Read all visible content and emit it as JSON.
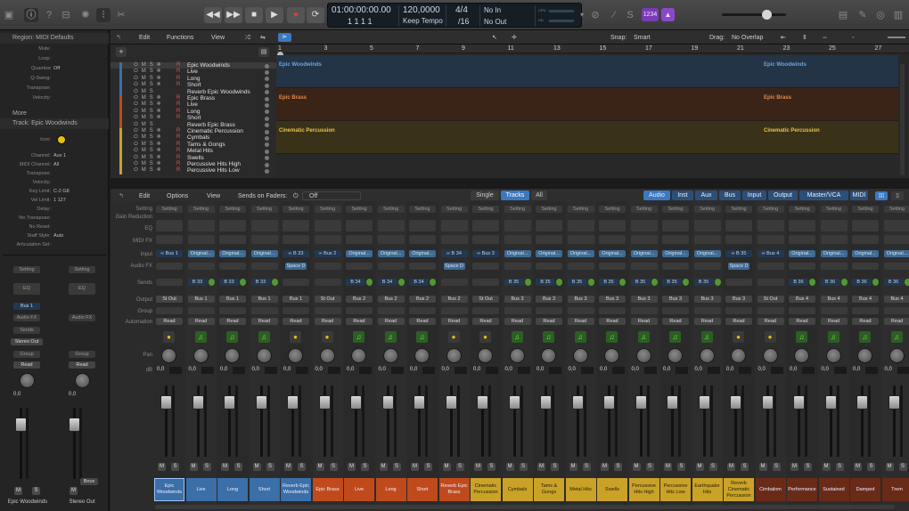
{
  "control_bar": {
    "lcd": {
      "timecode": "01:00:00:00.00",
      "bars": "1  1  1  1",
      "tempo": "120,0000",
      "tempo_mode": "Keep Tempo",
      "signature": "4/4",
      "division": "/16",
      "in": "No In",
      "out": "No Out",
      "cpu_label": "CPU",
      "hd_label": "HD"
    },
    "badge": "1234"
  },
  "inspector": {
    "region_header": "Region: MIDI Defaults",
    "region_rows": [
      {
        "k": "Mute:",
        "v": ""
      },
      {
        "k": "Loop:",
        "v": ""
      },
      {
        "k": "Quantize",
        "v": "Off"
      },
      {
        "k": "Q-Swing:",
        "v": ""
      },
      {
        "k": "Transpose:",
        "v": ""
      },
      {
        "k": "Velocity:",
        "v": ""
      }
    ],
    "more": "More",
    "track_header": "Track: Epic Woodwinds",
    "track_rows": [
      {
        "k": "Icon:",
        "v": ""
      },
      {
        "k": "Channel:",
        "v": "Aux 1"
      },
      {
        "k": "MIDI Channel:",
        "v": "All"
      },
      {
        "k": "Transpose:",
        "v": ""
      },
      {
        "k": "Velocity:",
        "v": ""
      },
      {
        "k": "Key Limit:",
        "v": "C-2  G8"
      },
      {
        "k": "Vel Limit:",
        "v": "1  127"
      },
      {
        "k": "Delay:",
        "v": ""
      },
      {
        "k": "No Transpose:",
        "v": ""
      },
      {
        "k": "No Reset:",
        "v": ""
      },
      {
        "k": "Staff Style:",
        "v": "Auto"
      },
      {
        "k": "Articulation Set:",
        "v": ""
      }
    ],
    "strip_left": {
      "setting": "Setting",
      "eq": "EQ",
      "input": "Bus 1",
      "audio_fx": "Audio FX",
      "sends": "Sends",
      "output": "Stereo Out",
      "group": "Group",
      "automation": "Read",
      "value": "0,0",
      "name": "Epic Woodwinds"
    },
    "strip_right": {
      "setting": "Setting",
      "eq": "EQ",
      "audio_fx": "Audio FX",
      "group": "Group",
      "automation": "Read",
      "value": "0,0",
      "name": "Stereo Out",
      "bounce": "Bnce"
    }
  },
  "tracks_menu": {
    "edit": "Edit",
    "functions": "Functions",
    "view": "View",
    "snap_label": "Snap:",
    "snap_value": "Smart",
    "drag_label": "Drag:",
    "drag_value": "No Overlap"
  },
  "ruler": [
    "1",
    "3",
    "5",
    "7",
    "9",
    "11",
    "13",
    "15",
    "17",
    "19",
    "21",
    "23",
    "25",
    "27"
  ],
  "tracks": [
    {
      "name": "Epic Woodwinds",
      "color": "#3a6fa8",
      "rec": true
    },
    {
      "name": "Live",
      "color": "#3a6fa8",
      "rec": true
    },
    {
      "name": "Long",
      "color": "#3a6fa8",
      "rec": true
    },
    {
      "name": "Short",
      "color": "#3a6fa8",
      "rec": true
    },
    {
      "name": "Reverb Epic Woodwinds",
      "color": "#3a6fa8",
      "rec": false
    },
    {
      "name": "Epic Brass",
      "color": "#c04a1c",
      "rec": true
    },
    {
      "name": "Live",
      "color": "#c04a1c",
      "rec": true
    },
    {
      "name": "Long",
      "color": "#c04a1c",
      "rec": true
    },
    {
      "name": "Short",
      "color": "#c04a1c",
      "rec": true
    },
    {
      "name": "Reverb Epic Brass",
      "color": "#c04a1c",
      "rec": false
    },
    {
      "name": "Cinematic Percussion",
      "color": "#c9a227",
      "rec": true
    },
    {
      "name": "Cymbals",
      "color": "#c9a227",
      "rec": true
    },
    {
      "name": "Tams & Gongs",
      "color": "#c9a227",
      "rec": true
    },
    {
      "name": "Metal Hits",
      "color": "#c9a227",
      "rec": true
    },
    {
      "name": "Swells",
      "color": "#c9a227",
      "rec": true
    },
    {
      "name": "Percussive Hits High",
      "color": "#c9a227",
      "rec": true
    },
    {
      "name": "Percussive Hits Low",
      "color": "#c9a227",
      "rec": true
    }
  ],
  "regions": [
    {
      "label": "Epic Woodwinds",
      "label2": "Epic Woodwinds",
      "color": "#6fa2d8"
    },
    {
      "label": "Epic Brass",
      "label2": "Epic Brass",
      "color": "#e0884f"
    },
    {
      "label": "Cinematic Percussion",
      "label2": "Cinematic Percussion",
      "color": "#e8c24a"
    }
  ],
  "mixer_menu": {
    "edit": "Edit",
    "options": "Options",
    "view": "View",
    "sends_on_faders": "Sends on Faders:",
    "sends_value": "Off",
    "modes": [
      "Single",
      "Tracks",
      "All"
    ],
    "filters": [
      "Audio",
      "Inst",
      "Aux",
      "Bus",
      "Input",
      "Output",
      "Master/VCA",
      "MIDI"
    ]
  },
  "row_labels": {
    "setting": "Setting",
    "gain": "Gain Reduction",
    "eq": "EQ",
    "midi_fx": "MIDI FX",
    "input": "Input",
    "audio_fx": "Audio FX",
    "sends": "Sends",
    "output": "Output",
    "group": "Group",
    "automation": "Automation",
    "pan": "Pan",
    "db": "dB"
  },
  "channels": [
    {
      "name": "Epic Woodwinds",
      "color": "#3a6fa8",
      "type": "aux",
      "input": "Bus 1",
      "insert": "",
      "send": "",
      "output": "St Out",
      "value": "0,0"
    },
    {
      "name": "Live",
      "color": "#3a6fa8",
      "type": "inst",
      "input": "Original...",
      "insert": "",
      "send": "B 33",
      "output": "Bus 1",
      "value": "0,0"
    },
    {
      "name": "Long",
      "color": "#3a6fa8",
      "type": "inst",
      "input": "Original...",
      "insert": "",
      "send": "B 33",
      "output": "Bus 1",
      "value": "0,0"
    },
    {
      "name": "Short",
      "color": "#3a6fa8",
      "type": "inst",
      "input": "Original...",
      "insert": "",
      "send": "B 33",
      "output": "Bus 1",
      "value": "0,0"
    },
    {
      "name": "Reverb Epic Woodwinds",
      "color": "#3a6fa8",
      "type": "aux",
      "input": "B 33",
      "insert": "Space D",
      "send": "",
      "output": "Bus 1",
      "value": "0,0"
    },
    {
      "name": "Epic Brass",
      "color": "#c04a1c",
      "type": "aux",
      "input": "Bus 2",
      "insert": "",
      "send": "",
      "output": "St Out",
      "value": "0,0"
    },
    {
      "name": "Live",
      "color": "#c04a1c",
      "type": "inst",
      "input": "Original...",
      "insert": "",
      "send": "B 34",
      "output": "Bus 2",
      "value": "0,0"
    },
    {
      "name": "Long",
      "color": "#c04a1c",
      "type": "inst",
      "input": "Original...",
      "insert": "",
      "send": "B 34",
      "output": "Bus 2",
      "value": "0,0"
    },
    {
      "name": "Short",
      "color": "#c04a1c",
      "type": "inst",
      "input": "Original...",
      "insert": "",
      "send": "B 34",
      "output": "Bus 2",
      "value": "0,0"
    },
    {
      "name": "Reverb Epic Brass",
      "color": "#c04a1c",
      "type": "aux",
      "input": "B 34",
      "insert": "Space D",
      "send": "",
      "output": "Bus 2",
      "value": "0,0"
    },
    {
      "name": "Cinematic Percussion",
      "color": "#c9a227",
      "type": "aux",
      "input": "Bus 3",
      "insert": "",
      "send": "",
      "output": "St Out",
      "value": "0,0"
    },
    {
      "name": "Cymbals",
      "color": "#c9a227",
      "type": "inst",
      "input": "Original...",
      "insert": "",
      "send": "B 35",
      "output": "Bus 3",
      "value": "0,0"
    },
    {
      "name": "Tams & Gongs",
      "color": "#c9a227",
      "type": "inst",
      "input": "Original...",
      "insert": "",
      "send": "B 35",
      "output": "Bus 3",
      "value": "0,0"
    },
    {
      "name": "Metal Hits",
      "color": "#c9a227",
      "type": "inst",
      "input": "Original...",
      "insert": "",
      "send": "B 35",
      "output": "Bus 3",
      "value": "0,0"
    },
    {
      "name": "Swells",
      "color": "#c9a227",
      "type": "inst",
      "input": "Original...",
      "insert": "",
      "send": "B 35",
      "output": "Bus 3",
      "value": "0,0"
    },
    {
      "name": "Percussive Hits High",
      "color": "#c9a227",
      "type": "inst",
      "input": "Original...",
      "insert": "",
      "send": "B 35",
      "output": "Bus 3",
      "value": "0,0"
    },
    {
      "name": "Percussive Hits Low",
      "color": "#c9a227",
      "type": "inst",
      "input": "Original...",
      "insert": "",
      "send": "B 35",
      "output": "Bus 3",
      "value": "0,0"
    },
    {
      "name": "Earthquake Hits",
      "color": "#c9a227",
      "type": "inst",
      "input": "Original...",
      "insert": "",
      "send": "B 35",
      "output": "Bus 3",
      "value": "0,0"
    },
    {
      "name": "Reverb Cinematic Percussion",
      "color": "#c9a227",
      "type": "aux",
      "input": "B 35",
      "insert": "Space D",
      "send": "",
      "output": "Bus 3",
      "value": "0,0"
    },
    {
      "name": "Cimbalom",
      "color": "#6a2a18",
      "type": "aux",
      "input": "Bus 4",
      "insert": "",
      "send": "",
      "output": "St Out",
      "value": "0,0"
    },
    {
      "name": "Performance",
      "color": "#6a2a18",
      "type": "inst",
      "input": "Original...",
      "insert": "",
      "send": "B 36",
      "output": "Bus 4",
      "value": "0,0"
    },
    {
      "name": "Sustained",
      "color": "#6a2a18",
      "type": "inst",
      "input": "Original...",
      "insert": "",
      "send": "B 36",
      "output": "Bus 4",
      "value": "0,0"
    },
    {
      "name": "Damped",
      "color": "#6a2a18",
      "type": "inst",
      "input": "Original...",
      "insert": "",
      "send": "B 36",
      "output": "Bus 4",
      "value": "0,0"
    },
    {
      "name": "Trem",
      "color": "#6a2a18",
      "type": "inst",
      "input": "Original...",
      "insert": "",
      "send": "B 36",
      "output": "Bus 4",
      "value": "0,0"
    }
  ],
  "strip_common": {
    "setting": "Setting",
    "read": "Read",
    "mute": "M",
    "solo": "S"
  },
  "colors": {
    "accent": "#2f7ad1",
    "selected_filter": "#3c78c0"
  }
}
